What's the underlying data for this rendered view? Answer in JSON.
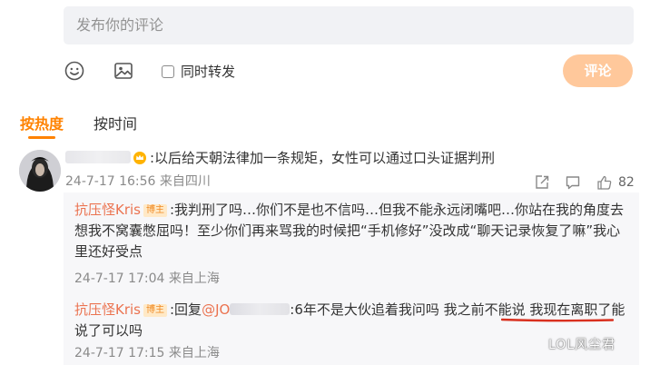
{
  "composer": {
    "placeholder": "发布你的评论",
    "repost_label": "同时转发",
    "submit_label": "评论",
    "icons": [
      "emoji-icon",
      "image-icon"
    ],
    "submit_color": "#ffc89b"
  },
  "sort": {
    "hot_label": "按热度",
    "time_label": "按时间",
    "active": "hot",
    "accent": "#ff8200"
  },
  "top_comment": {
    "text": ":以后给天朝法律加一条规矩，女性可以通过口头证据判刑",
    "time": "24-7-17 16:56",
    "location": "来自四川",
    "likes": "82"
  },
  "replies": [
    {
      "author": "抗压怪Kris",
      "badge": "博主",
      "text": ":我判刑了吗…你们不是也不信吗…但我不能永远闭嘴吧…你站在我的角度去想我不窝囊憋屈吗！至少你们再来骂我的时候把“手机修好”没改成“聊天记录恢复了嘛”我心里还好受点",
      "time": "24-7-17 17:04",
      "location": "来自上海"
    },
    {
      "author": "抗压怪Kris",
      "badge": "博主",
      "prefix": ":回复",
      "mention": "@JO",
      "text": ":6年不是大伙追着我问吗 我之前不能说 我现在离职了能说了可以吗",
      "time": "24-7-17 17:15",
      "location": "来自上海"
    }
  ],
  "watermark": "LOL风尘君",
  "colors": {
    "author": "#eb7350",
    "underline": "#d9301f"
  }
}
